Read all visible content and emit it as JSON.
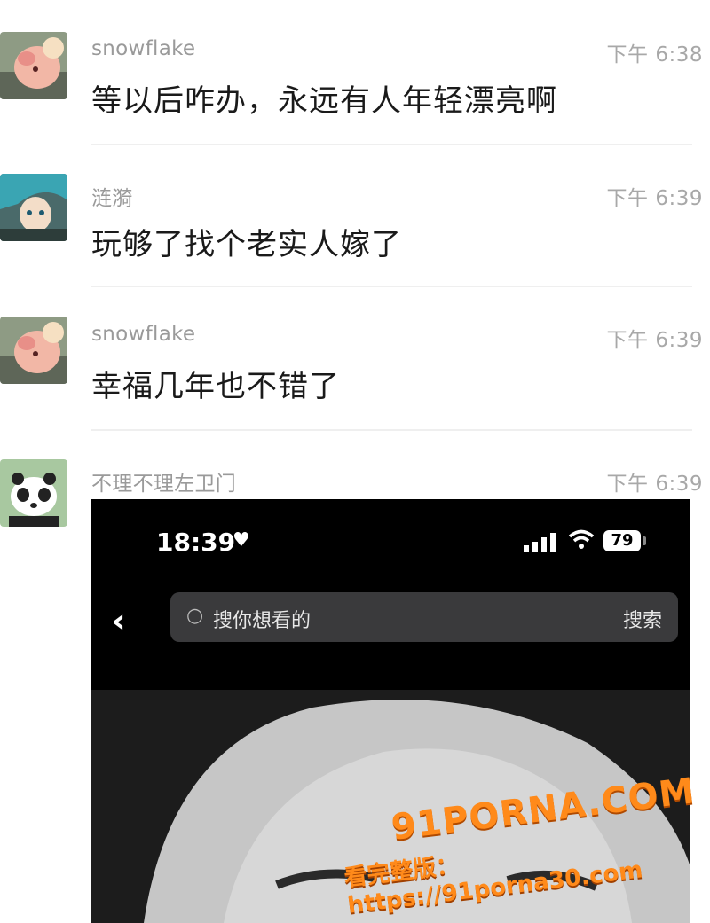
{
  "messages": [
    {
      "sender": "snowflake",
      "time": "下午 6:38",
      "text": "等以后咋办，永远有人年轻漂亮啊"
    },
    {
      "sender": "涟漪",
      "time": "下午 6:39",
      "text": "玩够了找个老实人嫁了"
    },
    {
      "sender": "snowflake",
      "time": "下午 6:39",
      "text": "幸福几年也不错了"
    },
    {
      "sender": "不理不理左卫门",
      "time": "下午 6:39",
      "image": true
    }
  ],
  "screenshot": {
    "clock": "18:39",
    "heart": "♥",
    "battery": "79",
    "back_icon": "‹",
    "search_icon": "○",
    "search_placeholder": "搜你想看的",
    "search_button": "搜索"
  },
  "watermark": {
    "logo": "91PORNA.COM",
    "text": "看完整版：https://91porna30.com"
  }
}
